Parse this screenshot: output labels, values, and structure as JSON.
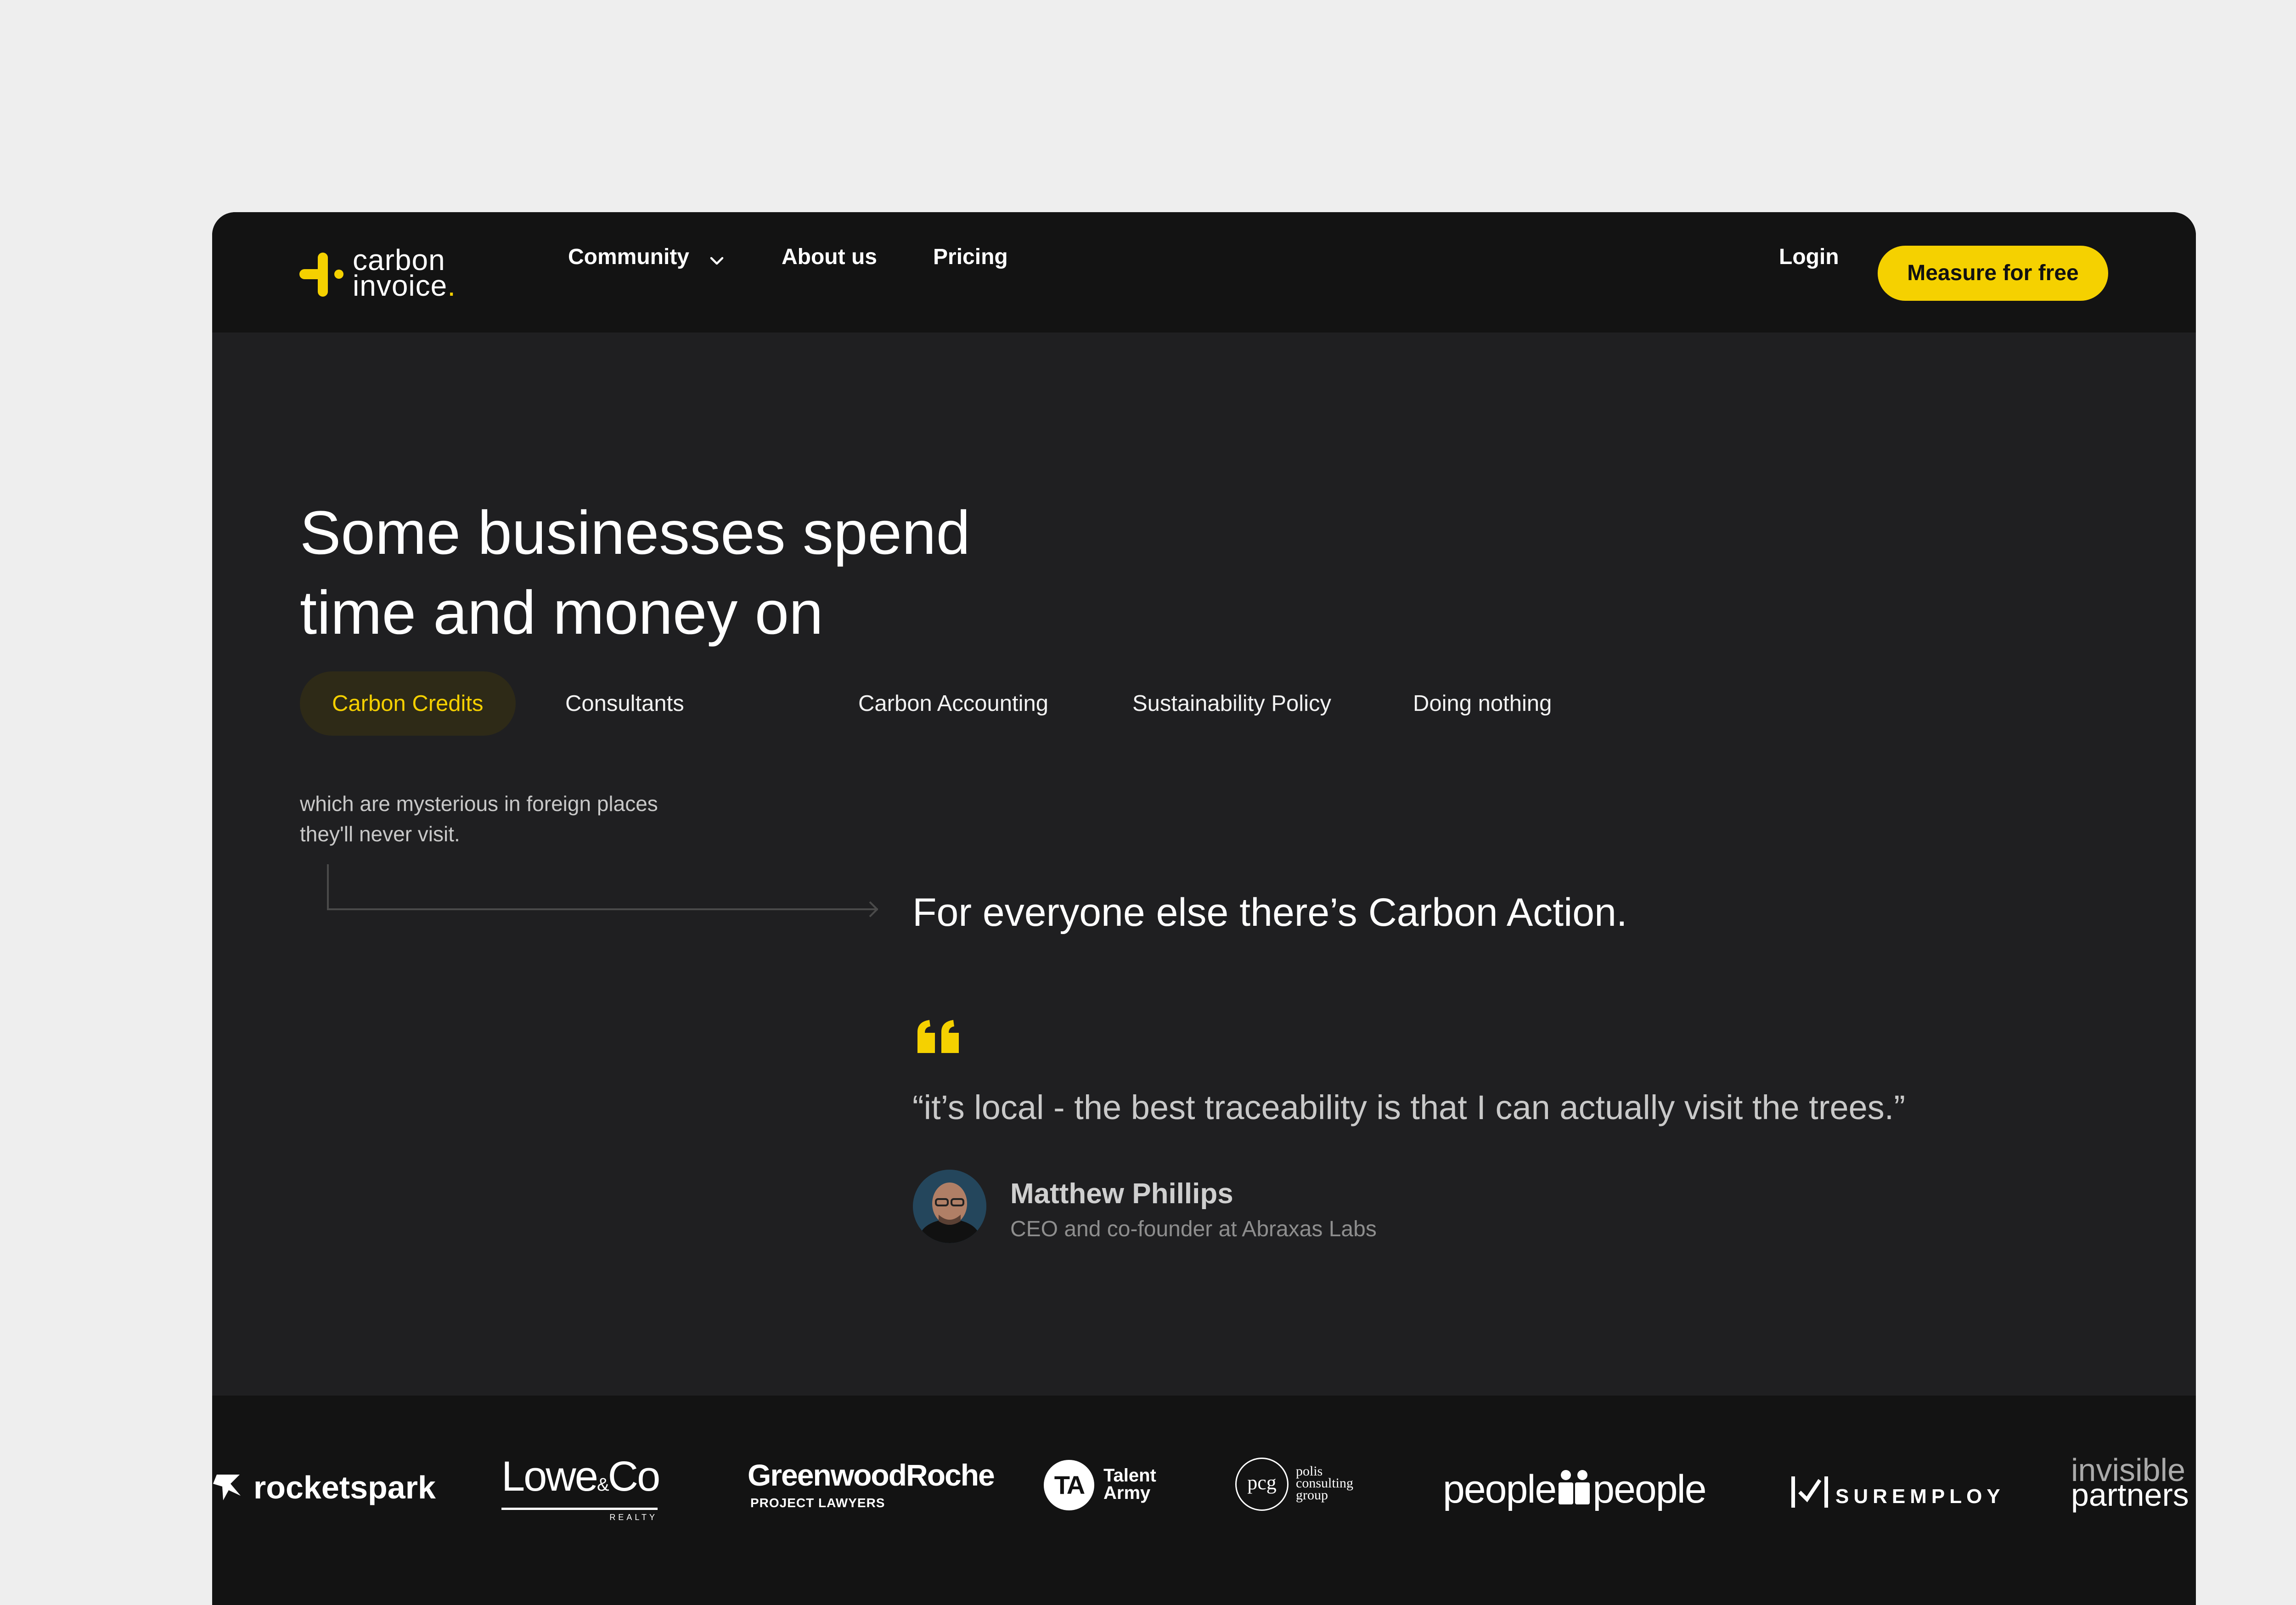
{
  "nav": {
    "logo_line1": "carbon",
    "logo_line2": "invoice",
    "logo_dot": ".",
    "items": [
      {
        "label": "Community"
      },
      {
        "label": "About us"
      },
      {
        "label": "Pricing"
      }
    ],
    "login_label": "Login",
    "cta_label": "Measure for free"
  },
  "hero": {
    "headline_line1": "Some businesses spend",
    "headline_line2": "time and money on",
    "tabs": [
      {
        "label": "Carbon Credits",
        "active": true
      },
      {
        "label": "Consultants",
        "active": false
      },
      {
        "label": "Carbon Accounting",
        "active": false
      },
      {
        "label": "Sustainability Policy",
        "active": false
      },
      {
        "label": "Doing nothing",
        "active": false
      }
    ],
    "description_line1": "which are mysterious in foreign places",
    "description_line2": "they'll never visit.",
    "tagline": "For everyone else there’s Carbon Action."
  },
  "testimonial": {
    "quote": "“it’s local - the best traceability is that I can actually visit the trees.”",
    "author_name": "Matthew Phillips",
    "author_role": "CEO and co-founder at Abraxas Labs"
  },
  "client_logos": {
    "rocketspark": "rocketspark",
    "lowe_main": "Lowe",
    "lowe_amp": "&",
    "lowe_co": "Co",
    "lowe_sub": "REALTY",
    "greenwood_main": "GreenwoodRoche",
    "greenwood_sub": "PROJECT LAWYERS",
    "talent_mark": "TA",
    "talent_line1": "Talent",
    "talent_line2": "Army",
    "polis_mark": "pcg",
    "polis_line1": "polis",
    "polis_line2": "consulting",
    "polis_line3": "group",
    "people_left": "people",
    "people_right": "people",
    "suremploy": "SUREMPLOY",
    "invisible_line1": "invisible",
    "invisible_line2": "partners"
  },
  "colors": {
    "accent": "#f5d100",
    "page_bg": "#eeeeee",
    "hero_bg": "#1f1f21",
    "nav_bg": "#131313"
  }
}
